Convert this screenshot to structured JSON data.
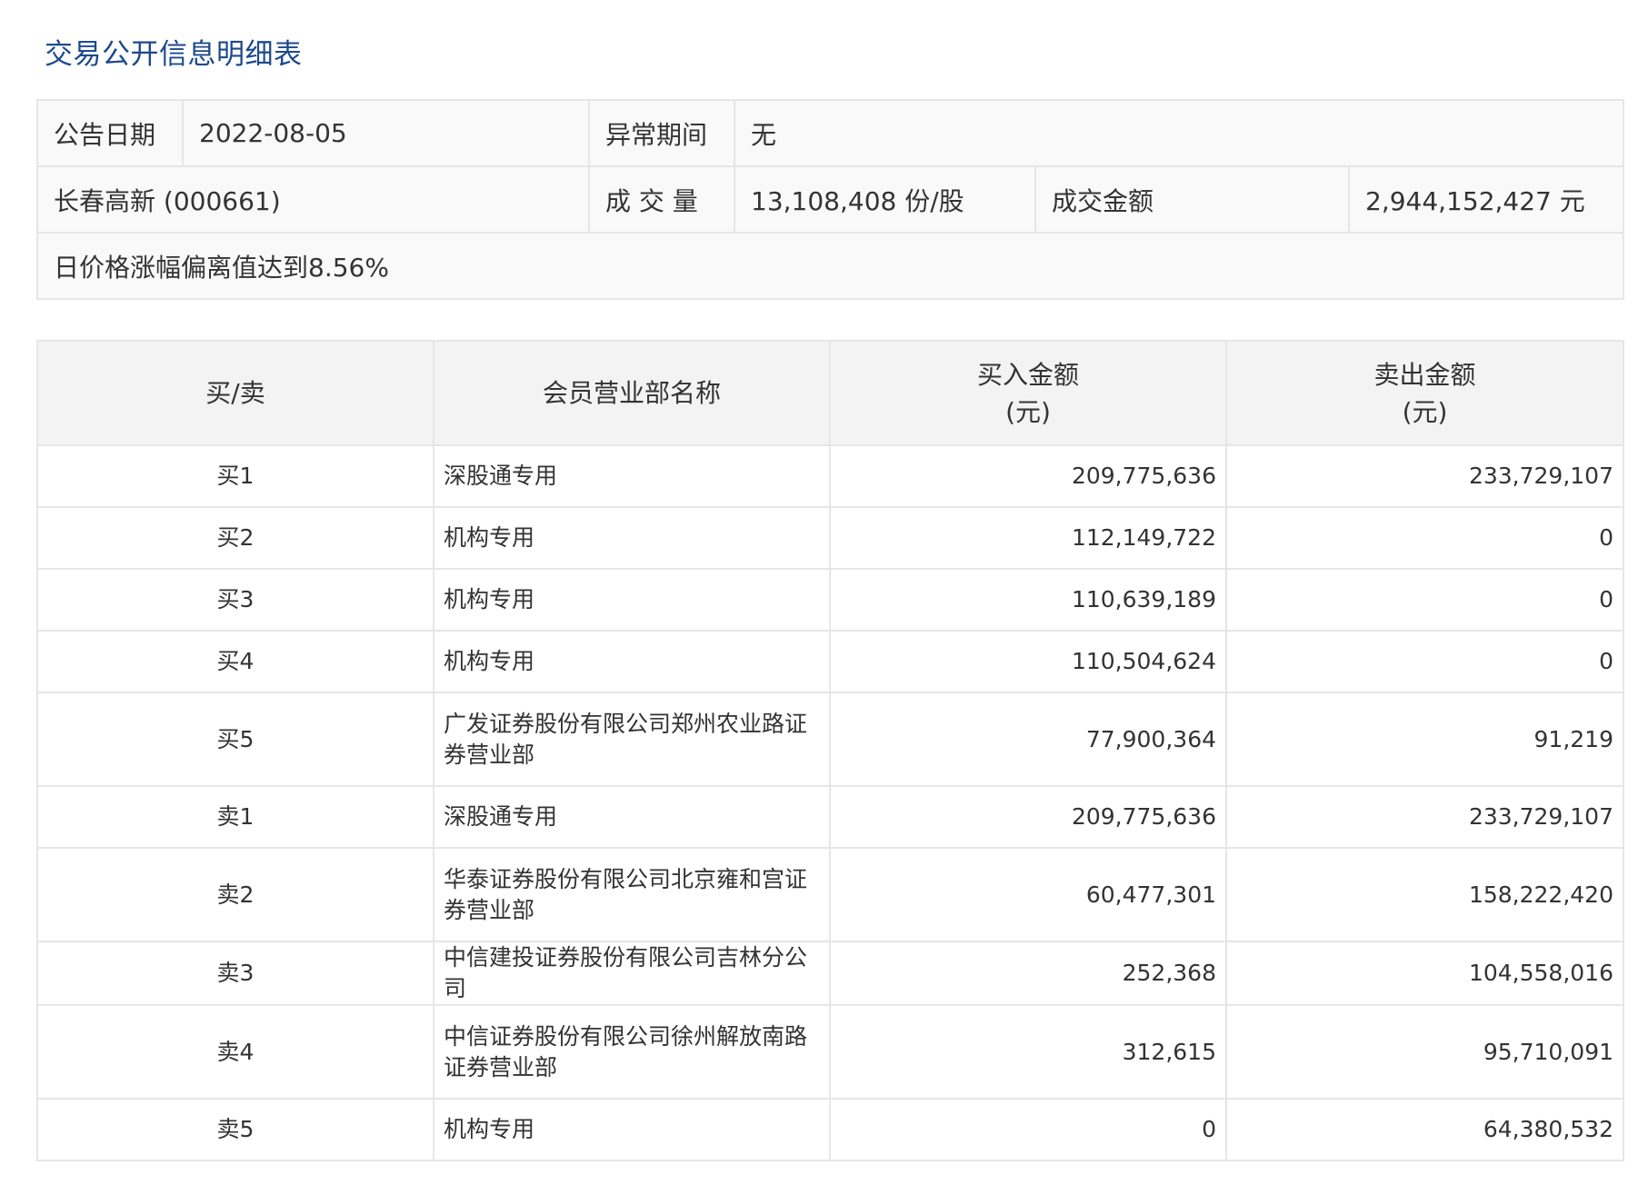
{
  "title": "交易公开信息明细表",
  "info": {
    "date_label": "公告日期",
    "date_value": "2022-08-05",
    "period_label": "异常期间",
    "period_value": "无",
    "stock": "长春高新 (000661)",
    "volume_label": "成 交 量",
    "volume_value": "13,108,408 份/股",
    "amount_label": "成交金额",
    "amount_value": "2,944,152,427 元",
    "reason": "日价格涨幅偏离值达到8.56%"
  },
  "table": {
    "headers": {
      "side": "买/卖",
      "name": "会员营业部名称",
      "buy_line1": "买入金额",
      "buy_line2": "(元)",
      "sell_line1": "卖出金额",
      "sell_line2": "(元)"
    },
    "rows": [
      {
        "side": "买1",
        "name": "深股通专用",
        "buy": "209,775,636",
        "sell": "233,729,107"
      },
      {
        "side": "买2",
        "name": "机构专用",
        "buy": "112,149,722",
        "sell": "0"
      },
      {
        "side": "买3",
        "name": "机构专用",
        "buy": "110,639,189",
        "sell": "0"
      },
      {
        "side": "买4",
        "name": "机构专用",
        "buy": "110,504,624",
        "sell": "0"
      },
      {
        "side": "买5",
        "name": "广发证券股份有限公司郑州农业路证券营业部",
        "buy": "77,900,364",
        "sell": "91,219"
      },
      {
        "side": "卖1",
        "name": "深股通专用",
        "buy": "209,775,636",
        "sell": "233,729,107"
      },
      {
        "side": "卖2",
        "name": "华泰证券股份有限公司北京雍和宫证券营业部",
        "buy": "60,477,301",
        "sell": "158,222,420"
      },
      {
        "side": "卖3",
        "name": "中信建投证券股份有限公司吉林分公司",
        "buy": "252,368",
        "sell": "104,558,016"
      },
      {
        "side": "卖4",
        "name": "中信证券股份有限公司徐州解放南路证券营业部",
        "buy": "312,615",
        "sell": "95,710,091"
      },
      {
        "side": "卖5",
        "name": "机构专用",
        "buy": "0",
        "sell": "64,380,532"
      }
    ]
  }
}
